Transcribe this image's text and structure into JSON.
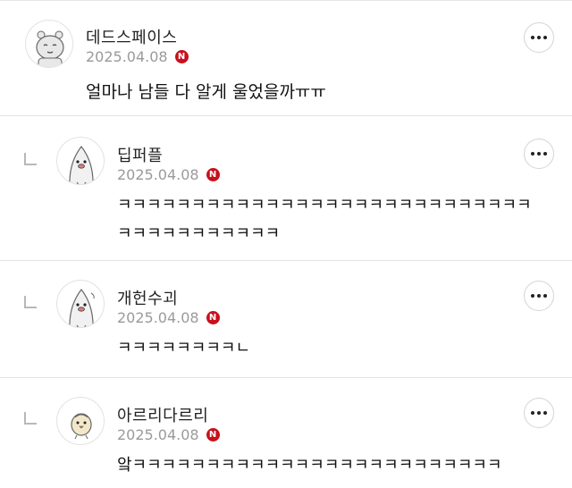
{
  "comments": [
    {
      "nickname": "데드스페이스",
      "date": "2025.04.08",
      "badge": "N",
      "text": "얼마나 남들 다 알게 울었을까ㅠㅠ",
      "avatar_icon": "bear-face-avatar",
      "is_reply": false
    },
    {
      "nickname": "딥퍼플",
      "date": "2025.04.08",
      "badge": "N",
      "text": "ㅋㅋㅋㅋㅋㅋㅋㅋㅋㅋㅋㅋㅋㅋㅋㅋㅋㅋㅋㅋㅋㅋㅋㅋㅋㅋㅋㅋㅋㅋㅋㅋㅋㅋㅋㅋㅋㅋㅋ",
      "avatar_icon": "penguin-avatar",
      "is_reply": true
    },
    {
      "nickname": "개헌수괴",
      "date": "2025.04.08",
      "badge": "N",
      "text": "ㅋㅋㅋㅋㅋㅋㅋㅋㄴ",
      "avatar_icon": "penguin-avatar",
      "is_reply": true
    },
    {
      "nickname": "아르리다르리",
      "date": "2025.04.08",
      "badge": "N",
      "text": "앜ㅋㅋㅋㅋㅋㅋㅋㅋㅋㅋㅋㅋㅋㅋㅋㅋㅋㅋㅋㅋㅋㅋㅋㅋㅋ",
      "avatar_icon": "chick-avatar",
      "is_reply": true
    }
  ],
  "colors": {
    "badge_red": "#c8101c",
    "date_gray": "#9a9a9a",
    "divider": "#e3e3e3"
  }
}
